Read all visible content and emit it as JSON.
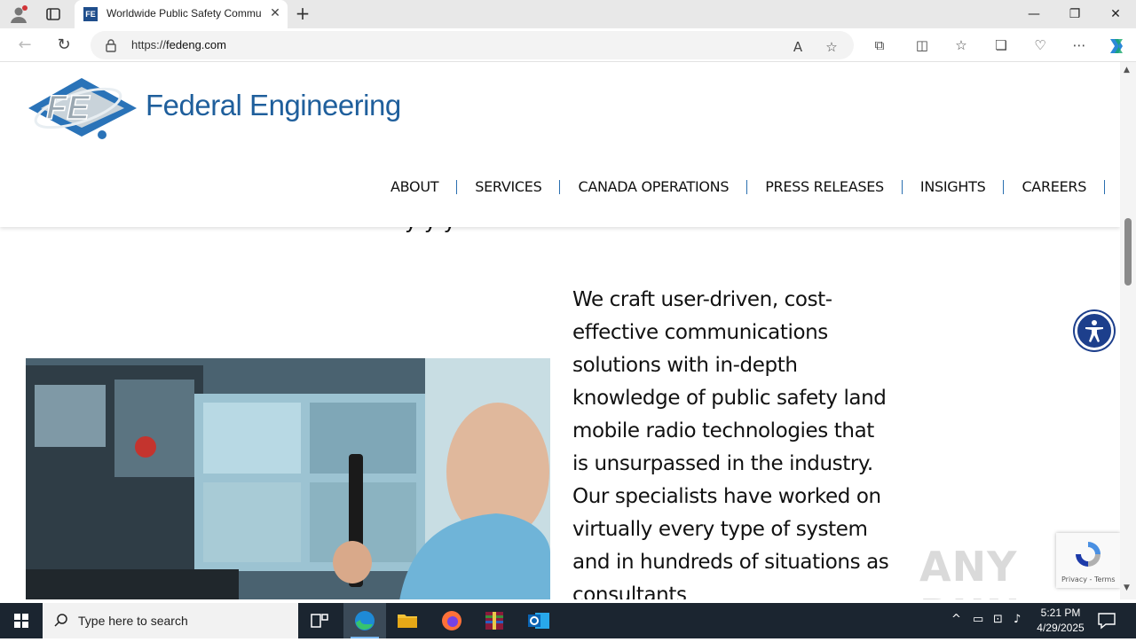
{
  "browser": {
    "tab_title": "Worldwide Public Safety Commu",
    "favicon_text": "FE",
    "url_scheme": "https://",
    "url_host": "fedeng.com",
    "controls": {
      "minimize": "—",
      "restore": "❐",
      "close": "✕",
      "new_tab": "+",
      "tab_close": "✕"
    }
  },
  "site": {
    "brand": "Federal Engineering",
    "logo_letters": "FE",
    "nav": [
      "ABOUT",
      "SERVICES",
      "CANADA OPERATIONS",
      "PRESS RELEASES",
      "INSIGHTS",
      "CAREERS"
    ],
    "cut_heading": "y y y",
    "body_text": "We craft user-driven, cost-effective communications solutions with in-depth knowledge of public safety land mobile radio technologies that is unsurpassed in the industry. Our specialists have worked on virtually every type of system and in hundreds of situations as consultants",
    "recaptcha_links": "Privacy - Terms",
    "watermark": "ANY RUN"
  },
  "taskbar": {
    "search_placeholder": "Type here to search",
    "time": "5:21 PM",
    "date": "4/29/2025"
  },
  "colors": {
    "brand_blue": "#1f5f9c",
    "accessibility_blue": "#1d3f8c",
    "taskbar": "#1b2530"
  }
}
